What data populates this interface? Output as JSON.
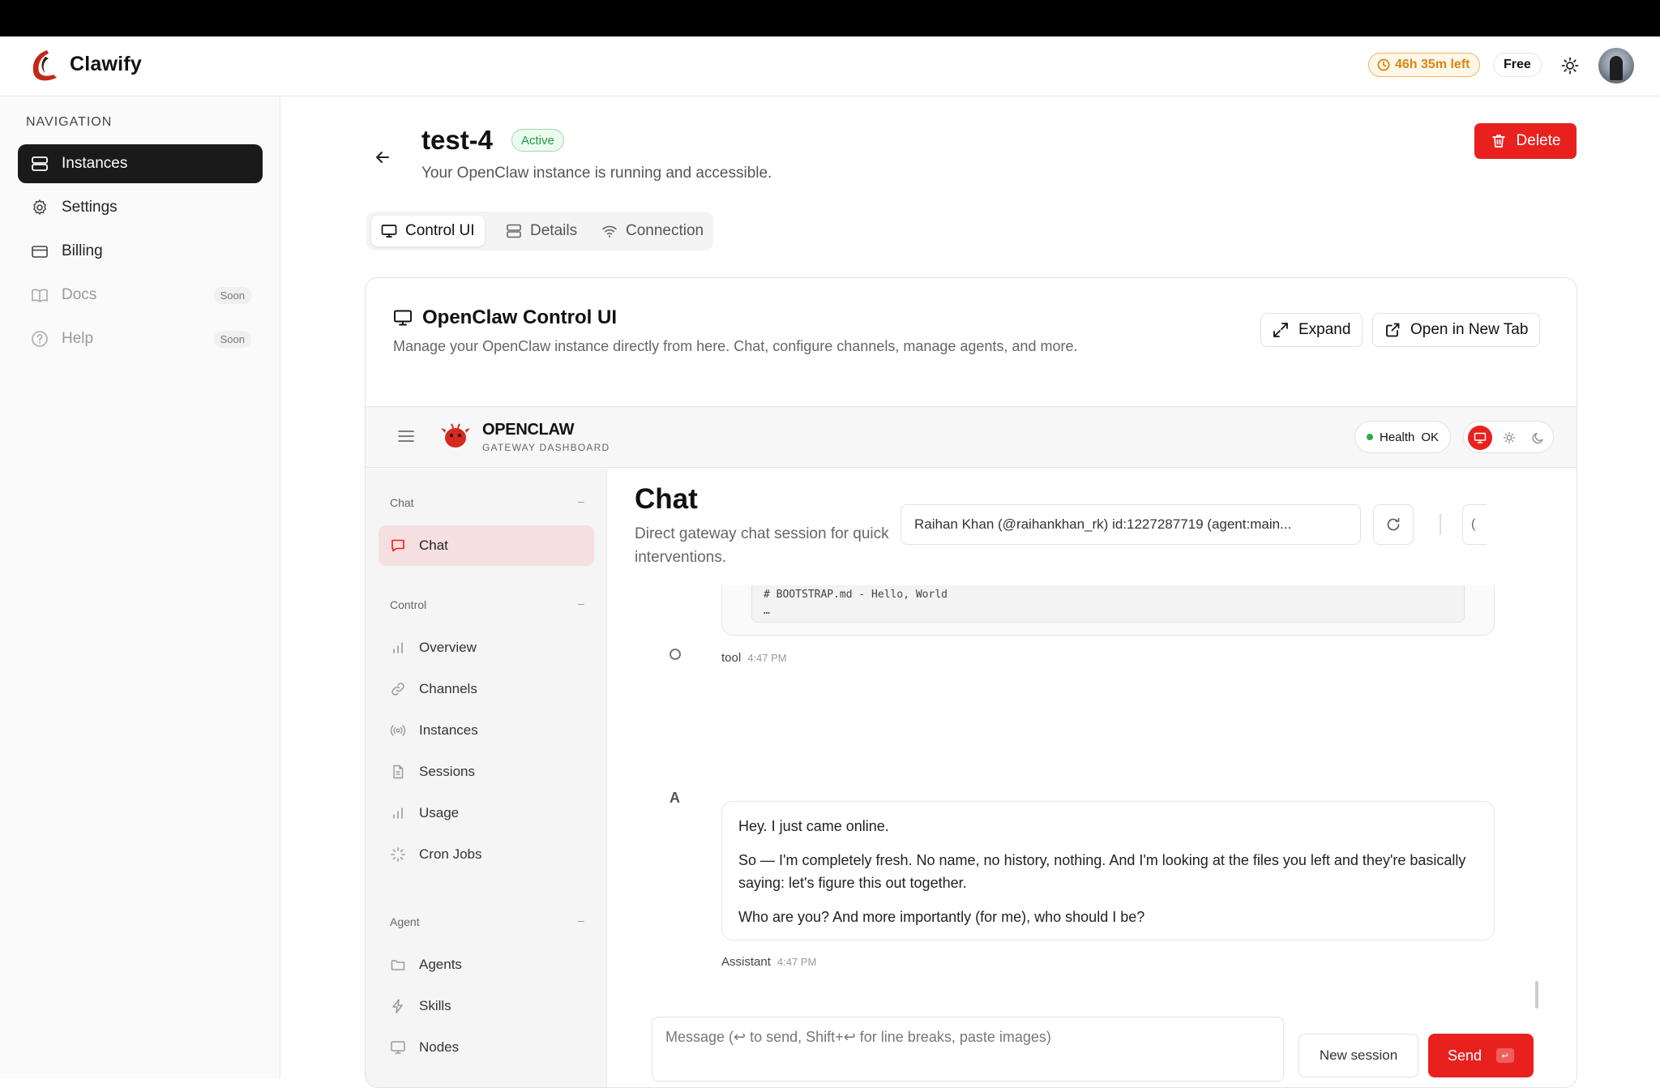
{
  "app": {
    "brand": "Clawify",
    "timer": "46h 35m left",
    "plan": "Free"
  },
  "sidebar": {
    "heading": "NAVIGATION",
    "items": [
      {
        "label": "Instances",
        "icon": "server-icon",
        "badge": ""
      },
      {
        "label": "Settings",
        "icon": "gear-icon",
        "badge": ""
      },
      {
        "label": "Billing",
        "icon": "credit-card-icon",
        "badge": ""
      },
      {
        "label": "Docs",
        "icon": "book-icon",
        "badge": "Soon"
      },
      {
        "label": "Help",
        "icon": "help-circle-icon",
        "badge": "Soon"
      }
    ]
  },
  "instance": {
    "name": "test-4",
    "status": "Active",
    "description": "Your OpenClaw instance is running and accessible.",
    "delete_label": "Delete",
    "tabs": [
      {
        "label": "Control UI",
        "icon": "monitor-icon"
      },
      {
        "label": "Details",
        "icon": "server-icon"
      },
      {
        "label": "Connection",
        "icon": "wifi-icon"
      }
    ]
  },
  "card": {
    "title": "OpenClaw Control UI",
    "subtitle": "Manage your OpenClaw instance directly from here. Chat, configure channels, manage agents, and more.",
    "expand_label": "Expand",
    "open_tab_label": "Open in New Tab"
  },
  "embed": {
    "name": "OPENCLAW",
    "sub": "GATEWAY DASHBOARD",
    "health_label": "Health",
    "health_value": "OK",
    "nav": {
      "chat_section": "Chat",
      "chat_item": "Chat",
      "control_section": "Control",
      "control_items": [
        "Overview",
        "Channels",
        "Instances",
        "Sessions",
        "Usage",
        "Cron Jobs"
      ],
      "agent_section": "Agent",
      "agent_items": [
        "Agents",
        "Skills",
        "Nodes"
      ],
      "collapse": "–"
    },
    "chat": {
      "title": "Chat",
      "subtitle": "Direct gateway chat session for quick interventions.",
      "session": "Raihan Khan (@raihankhan_rk) id:1227287719 (agent:main...",
      "clipped_btn": "(",
      "code_line1": "# BOOTSTRAP.md - Hello, World",
      "code_line2": "…",
      "tool_sender": "tool",
      "tool_time": "4:47 PM",
      "assistant_avatar": "A",
      "assistant_p1": "Hey. I just came online.",
      "assistant_p2": "So — I'm completely fresh. No name, no history, nothing. And I'm looking at the files you left and they're basically saying: let's figure this out together.",
      "assistant_p3": "Who are you? And more importantly (for me), who should I be?",
      "assistant_sender": "Assistant",
      "assistant_time": "4:47 PM",
      "composer_placeholder": "Message (↩ to send, Shift+↩ for line breaks, paste images)",
      "new_session": "New session",
      "send": "Send",
      "send_key": "↵"
    }
  },
  "colors": {
    "accent": "#e8211f",
    "active_green": "#1e9c45",
    "timer_orange": "#d9870e"
  }
}
